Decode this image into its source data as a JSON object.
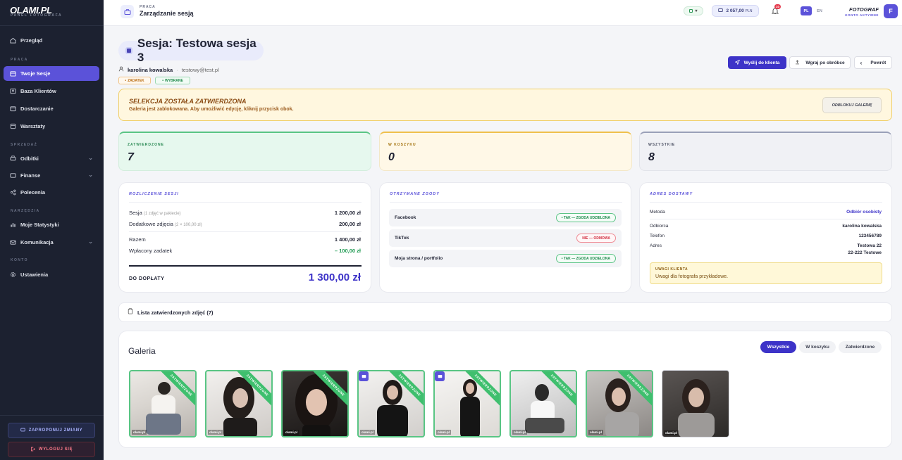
{
  "brand": {
    "logo": "OLAMI.PL",
    "subtitle": "PANEL FOTOGRAFA"
  },
  "sidebar": {
    "items": [
      {
        "label": "Przegląd"
      },
      {
        "section": "PRACA"
      },
      {
        "label": "Twoje Sesje",
        "active": true
      },
      {
        "label": "Baza Klientów"
      },
      {
        "label": "Dostarczanie"
      },
      {
        "label": "Warsztaty"
      },
      {
        "section": "SPRZEDAŻ"
      },
      {
        "label": "Odbitki"
      },
      {
        "label": "Finanse"
      },
      {
        "label": "Polecenia"
      },
      {
        "section": "NARZĘDZIA"
      },
      {
        "label": "Moje Statystyki"
      },
      {
        "label": "Komunikacja"
      },
      {
        "section": "KONTO"
      },
      {
        "label": "Ustawienia"
      }
    ],
    "propose_label": "ZAPROPONUJ ZMIANY",
    "logout_label": "WYLOGUJ SIĘ"
  },
  "topbar": {
    "kicker": "PRACA",
    "title": "Zarządzanie sesją",
    "balance": "2 057,00",
    "balance_currency": "PLN",
    "notif_count": "10",
    "lang_pl": "PL",
    "lang_en": "EN",
    "role": "FOTOGRAF",
    "role_sub": "KONTO AKTYWNE",
    "avatar": "F"
  },
  "session": {
    "title": "Sesja: Testowa sesja 3",
    "client_name": "karolina kowalska",
    "client_email": "testowy@test.pl",
    "tags": [
      "ZADATEK",
      "WYBRANE"
    ],
    "send_label": "Wyślij do klienta",
    "upload_label": "Wgraj po obróbce",
    "back_label": "Powrót"
  },
  "alert": {
    "title": "SELEKCJA ZOSTAŁA ZATWIERDZONA",
    "text": "Galeria jest zablokowana. Aby umożliwić edycję, kliknij przycisk obok.",
    "unlock_label": "ODBLOKUJ GALERIĘ"
  },
  "stats": [
    {
      "label": "ZATWIERDZONE",
      "value": "7"
    },
    {
      "label": "W KOSZYKU",
      "value": "0"
    },
    {
      "label": "WSZYSTKIE",
      "value": "8"
    }
  ],
  "billing": {
    "title": "ROZLICZENIE SESJI",
    "session_label": "Sesja",
    "session_note": "(1 zdjęć w pakiecie)",
    "session_value": "1 200,00 zł",
    "extra_label": "Dodatkowe zdjęcia",
    "extra_note": "(2 × 100,00 zł)",
    "extra_value": "200,00 zł",
    "total_label": "Razem",
    "total_value": "1 400,00 zł",
    "deposit_label": "Wpłacony zadatek",
    "deposit_value": "– 100,00 zł",
    "due_label": "DO DOPŁATY",
    "due_value": "1 300,00 zł"
  },
  "consents": {
    "title": "OTRZYMANE ZGODY",
    "items": [
      {
        "label": "Facebook",
        "status": "• TAK — ZGODA UDZIELONA",
        "ok": true
      },
      {
        "label": "TikTok",
        "status": "NIE — ODMOWA",
        "ok": false
      },
      {
        "label": "Moja strona / portfolio",
        "status": "• TAK — ZGODA UDZIELONA",
        "ok": true
      }
    ]
  },
  "delivery": {
    "title": "ADRES DOSTAWY",
    "method_label": "Metoda",
    "method_value": "Odbiór osobisty",
    "recipient_label": "Odbiorca",
    "recipient_value": "karolina kowalska",
    "phone_label": "Telefon",
    "phone_value": "123456789",
    "address_label": "Adres",
    "address_line1": "Testowa 22",
    "address_line2": "22-222 Testowe",
    "note_title": "UWAGI KLIENTA",
    "note_text": "Uwagi dla fotografa przykładowe."
  },
  "approved_list_label": "Lista zatwierdzonych zdjęć (7)",
  "gallery": {
    "title": "Galeria",
    "tabs": [
      "Wszystkie",
      "W koszyku",
      "Zatwierdzone"
    ],
    "ribbon": "ZATWIERDZONE",
    "watermark": "olami.pl"
  },
  "colors": {
    "accent": "#5b52d9",
    "sidebar": "#1c2130",
    "approved": "#3fbf6e"
  }
}
